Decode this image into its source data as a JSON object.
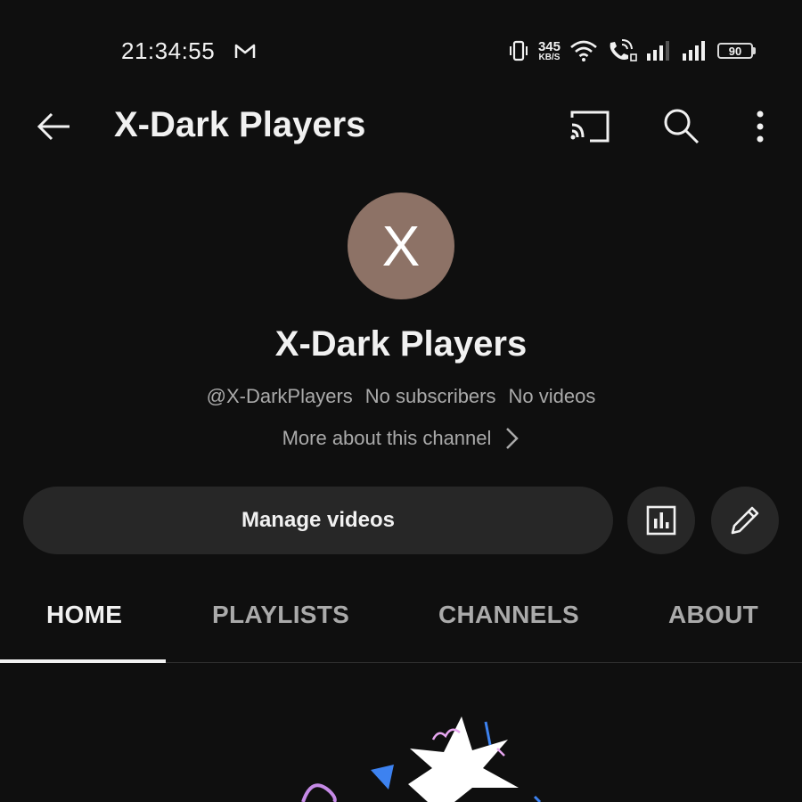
{
  "status_bar": {
    "time": "21:34:55",
    "net_speed_value": "345",
    "net_speed_unit": "KB/S",
    "battery_level": "90",
    "icons": [
      "gmail-icon",
      "vibrate-icon",
      "wifi-icon",
      "wifi-calling-icon",
      "signal-icon",
      "signal-icon"
    ]
  },
  "app_bar": {
    "title": "X-Dark Players",
    "icons": [
      "back-arrow-icon",
      "cast-icon",
      "search-icon",
      "more-vert-icon"
    ]
  },
  "channel": {
    "avatar_letter": "X",
    "avatar_color": "#8d7266",
    "name": "X-Dark Players",
    "handle": "@X-DarkPlayers",
    "subscribers": "No subscribers",
    "videos": "No videos",
    "more_about": "More about this channel"
  },
  "actions": {
    "manage_videos": "Manage videos",
    "icons": [
      "analytics-icon",
      "edit-pencil-icon"
    ]
  },
  "tabs": [
    {
      "label": "HOME",
      "active": true
    },
    {
      "label": "PLAYLISTS",
      "active": false
    },
    {
      "label": "CHANNELS",
      "active": false
    },
    {
      "label": "ABOUT",
      "active": false
    }
  ],
  "colors": {
    "background": "#0f0f0f",
    "surface": "#272727",
    "text_primary": "#f1f1f1",
    "text_secondary": "#aaaaaa"
  }
}
